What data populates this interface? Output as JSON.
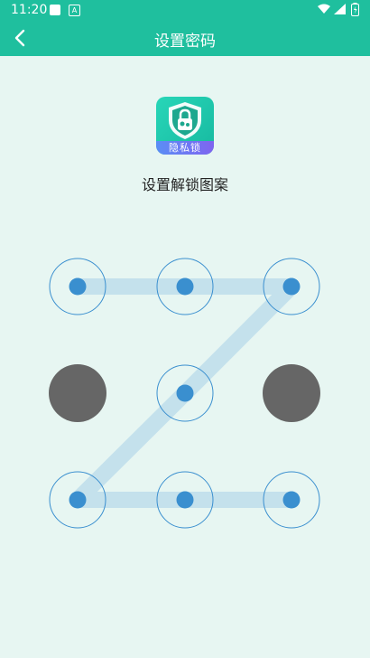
{
  "status_bar": {
    "time": "11:20",
    "badge_letter": "A"
  },
  "header": {
    "title": "设置密码"
  },
  "app_logo": {
    "label": "隐私锁"
  },
  "prompt": {
    "text": "设置解锁图案"
  },
  "pattern": {
    "grid": [
      3,
      3
    ],
    "selected_sequence": [
      1,
      2,
      3,
      5,
      7,
      8,
      9
    ],
    "unselected_dots": [
      4,
      6
    ],
    "colors": {
      "accent": "#1fbf9e",
      "selected_dot": "#3a8fcf",
      "ring": "#3a8fcf",
      "path": "#c4e1ec",
      "unselected_dot": "#666666"
    }
  }
}
